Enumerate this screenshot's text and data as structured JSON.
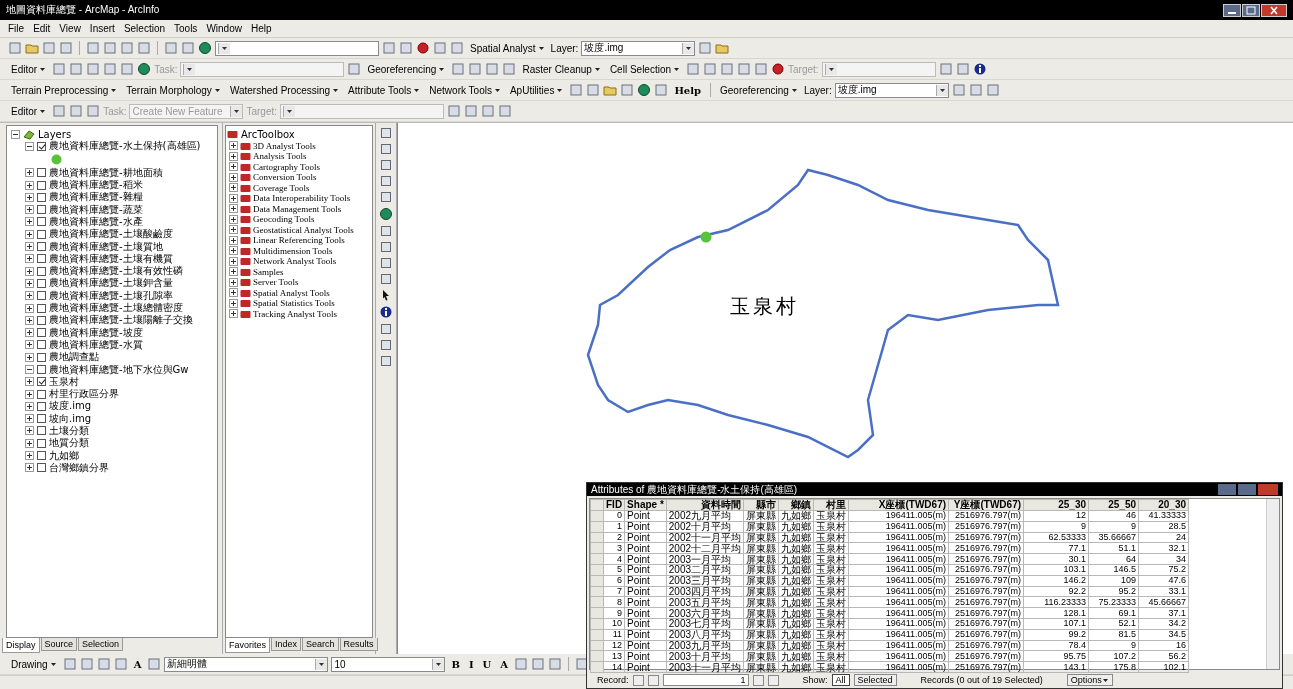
{
  "window": {
    "title": "地圖資料庫總覽 - ArcMap - ArcInfo"
  },
  "menu": [
    "File",
    "Edit",
    "View",
    "Insert",
    "Selection",
    "Tools",
    "Window",
    "Help"
  ],
  "toolbars": [
    [
      {
        "kind": "icon"
      },
      {
        "kind": "folder"
      },
      {
        "kind": "icon"
      },
      {
        "kind": "icon"
      },
      {
        "kind": "sep"
      },
      {
        "kind": "icon"
      },
      {
        "kind": "icon"
      },
      {
        "kind": "icon"
      },
      {
        "kind": "icon"
      },
      {
        "kind": "sep"
      },
      {
        "kind": "icon"
      },
      {
        "kind": "icon"
      },
      {
        "kind": "globe"
      },
      {
        "kind": "widecombo",
        "disabled": false
      },
      {
        "kind": "icon"
      },
      {
        "kind": "icon"
      },
      {
        "kind": "ball"
      },
      {
        "kind": "icon"
      },
      {
        "kind": "icon"
      },
      {
        "kind": "menu",
        "label": "Spatial Analyst"
      },
      {
        "kind": "combo",
        "label": "Layer:",
        "value": "坡度.img",
        "disabled": false
      },
      {
        "kind": "icon"
      },
      {
        "kind": "folder"
      }
    ],
    [
      {
        "kind": "menu",
        "label": "Editor"
      },
      {
        "kind": "icon"
      },
      {
        "kind": "icon"
      },
      {
        "kind": "icon"
      },
      {
        "kind": "icon"
      },
      {
        "kind": "icon"
      },
      {
        "kind": "globe"
      },
      {
        "kind": "widecombo",
        "label": "Task:",
        "disabled": true
      },
      {
        "kind": "icon"
      },
      {
        "kind": "menu",
        "label": "Georeferencing"
      },
      {
        "kind": "icon"
      },
      {
        "kind": "icon"
      },
      {
        "kind": "icon"
      },
      {
        "kind": "icon"
      },
      {
        "kind": "menu",
        "label": "Raster Cleanup"
      },
      {
        "kind": "menu",
        "label": "Cell Selection"
      },
      {
        "kind": "icon"
      },
      {
        "kind": "icon"
      },
      {
        "kind": "icon"
      },
      {
        "kind": "icon"
      },
      {
        "kind": "icon"
      },
      {
        "kind": "ball"
      },
      {
        "kind": "combo",
        "label": "Target:",
        "disabled": true
      },
      {
        "kind": "icon"
      },
      {
        "kind": "icon"
      },
      {
        "kind": "info"
      }
    ],
    [
      {
        "kind": "menu",
        "label": "Terrain Preprocessing"
      },
      {
        "kind": "menu",
        "label": "Terrain Morphology"
      },
      {
        "kind": "menu",
        "label": "Watershed Processing"
      },
      {
        "kind": "menu",
        "label": "Attribute Tools"
      },
      {
        "kind": "menu",
        "label": "Network Tools"
      },
      {
        "kind": "menu",
        "label": "ApUtilities"
      },
      {
        "kind": "icon"
      },
      {
        "kind": "icon"
      },
      {
        "kind": "folder"
      },
      {
        "kind": "icon"
      },
      {
        "kind": "globe"
      },
      {
        "kind": "icon"
      },
      {
        "kind": "text",
        "label": "Help"
      },
      {
        "kind": "sep"
      },
      {
        "kind": "menu",
        "label": "Georeferencing"
      },
      {
        "kind": "combo",
        "label": "Layer:",
        "value": "坡度.img",
        "disabled": false
      },
      {
        "kind": "icon"
      },
      {
        "kind": "icon"
      },
      {
        "kind": "icon"
      }
    ],
    [
      {
        "kind": "menu",
        "label": "Editor"
      },
      {
        "kind": "icon"
      },
      {
        "kind": "icon"
      },
      {
        "kind": "icon"
      },
      {
        "kind": "combo",
        "label": "Task:",
        "value": "Create New Feature",
        "disabled": true
      },
      {
        "kind": "widecombo",
        "label": "Target:",
        "disabled": true
      },
      {
        "kind": "icon"
      },
      {
        "kind": "icon"
      },
      {
        "kind": "icon"
      },
      {
        "kind": "icon"
      }
    ]
  ],
  "toc": {
    "root": "Layers",
    "layers": [
      {
        "name": "農地資料庫總覽-水土保持(高雄區)",
        "checked": true,
        "expanded": true
      },
      {
        "name": "農地資料庫總覽-耕地面積",
        "checked": false,
        "expanded": false
      },
      {
        "name": "農地資料庫總覽-稻米",
        "checked": false,
        "expanded": false
      },
      {
        "name": "農地資料庫總覽-雜糧",
        "checked": false,
        "expanded": false
      },
      {
        "name": "農地資料庫總覽-蔬菜",
        "checked": false,
        "expanded": false
      },
      {
        "name": "農地資料庫總覽-水產",
        "checked": false,
        "expanded": false
      },
      {
        "name": "農地資料庫總覽-土壤酸鹼度",
        "checked": false,
        "expanded": false
      },
      {
        "name": "農地資料庫總覽-土壤質地",
        "checked": false,
        "expanded": false
      },
      {
        "name": "農地資料庫總覽-土壤有機質",
        "checked": false,
        "expanded": false
      },
      {
        "name": "農地資料庫總覽-土壤有效性磷",
        "checked": false,
        "expanded": false
      },
      {
        "name": "農地資料庫總覽-土壤鉀含量",
        "checked": false,
        "expanded": false
      },
      {
        "name": "農地資料庫總覽-土壤孔隙率",
        "checked": false,
        "expanded": false
      },
      {
        "name": "農地資料庫總覽-土壤總體密度",
        "checked": false,
        "expanded": false
      },
      {
        "name": "農地資料庫總覽-土壤陽離子交換",
        "checked": false,
        "expanded": false
      },
      {
        "name": "農地資料庫總覽-坡度",
        "checked": false,
        "expanded": false
      },
      {
        "name": "農地資料庫總覽-水質",
        "checked": false,
        "expanded": false
      },
      {
        "name": "農地調查點",
        "checked": false,
        "expanded": false
      },
      {
        "name": "農地資料庫總覽-地下水位與Gw",
        "checked": false,
        "expanded": true
      },
      {
        "name": "玉泉村",
        "checked": true,
        "expanded": false
      },
      {
        "name": "村里行政區分界",
        "checked": false,
        "expanded": false
      },
      {
        "name": "坡度.img",
        "checked": false,
        "expanded": false
      },
      {
        "name": "坡向.img",
        "checked": false,
        "expanded": false
      },
      {
        "name": "土壤分類",
        "checked": false,
        "expanded": false
      },
      {
        "name": "地質分類",
        "checked": false,
        "expanded": false
      },
      {
        "name": "九如鄉",
        "checked": false,
        "expanded": false
      },
      {
        "name": "台灣鄉鎮分界",
        "checked": false,
        "expanded": false
      }
    ],
    "tabs": [
      {
        "label": "Display",
        "selected": true
      },
      {
        "label": "Source",
        "selected": false
      },
      {
        "label": "Selection",
        "selected": false
      }
    ]
  },
  "toolbox": {
    "root": "ArcToolbox",
    "items": [
      "3D Analyst Tools",
      "Analysis Tools",
      "Cartography Tools",
      "Conversion Tools",
      "Coverage Tools",
      "Data Interoperability Tools",
      "Data Management Tools",
      "Geocoding Tools",
      "Geostatistical Analyst Tools",
      "Linear Referencing Tools",
      "Multidimension Tools",
      "Network Analyst Tools",
      "Samples",
      "Server Tools",
      "Spatial Analyst Tools",
      "Spatial Statistics Tools",
      "Tracking Analyst Tools"
    ],
    "tabs": [
      {
        "label": "Favorites",
        "selected": true
      },
      {
        "label": "Index",
        "selected": false
      },
      {
        "label": "Search",
        "selected": false
      },
      {
        "label": "Results",
        "selected": false
      }
    ]
  },
  "map": {
    "label": "玉泉村"
  },
  "table": {
    "title": "Attributes of 農地資料庫總覽-水土保持(高雄區)",
    "columns": [
      "FID",
      "Shape *",
      "資料時間",
      "縣市",
      "鄉鎮",
      "村里",
      "X座標(TWD67)",
      "Y座標(TWD67)",
      "25_30",
      "25_50",
      "20_30"
    ],
    "rows": [
      [
        "0",
        "Point",
        "2002九月平均",
        "屏東縣",
        "九如鄉",
        "玉泉村",
        "196411.005(m)",
        "2516976.797(m)",
        "12",
        "46",
        "41.33333"
      ],
      [
        "1",
        "Point",
        "2002十月平均",
        "屏東縣",
        "九如鄉",
        "玉泉村",
        "196411.005(m)",
        "2516976.797(m)",
        "9",
        "9",
        "28.5"
      ],
      [
        "2",
        "Point",
        "2002十一月平均",
        "屏東縣",
        "九如鄉",
        "玉泉村",
        "196411.005(m)",
        "2516976.797(m)",
        "62.53333",
        "35.66667",
        "24"
      ],
      [
        "3",
        "Point",
        "2002十二月平均",
        "屏東縣",
        "九如鄉",
        "玉泉村",
        "196411.005(m)",
        "2516976.797(m)",
        "77.1",
        "51.1",
        "32.1"
      ],
      [
        "4",
        "Point",
        "2003一月平均",
        "屏東縣",
        "九如鄉",
        "玉泉村",
        "196411.005(m)",
        "2516976.797(m)",
        "30.1",
        "64",
        "34"
      ],
      [
        "5",
        "Point",
        "2003二月平均",
        "屏東縣",
        "九如鄉",
        "玉泉村",
        "196411.005(m)",
        "2516976.797(m)",
        "103.1",
        "146.5",
        "75.2"
      ],
      [
        "6",
        "Point",
        "2003三月平均",
        "屏東縣",
        "九如鄉",
        "玉泉村",
        "196411.005(m)",
        "2516976.797(m)",
        "146.2",
        "109",
        "47.6"
      ],
      [
        "7",
        "Point",
        "2003四月平均",
        "屏東縣",
        "九如鄉",
        "玉泉村",
        "196411.005(m)",
        "2516976.797(m)",
        "92.2",
        "95.2",
        "33.1"
      ],
      [
        "8",
        "Point",
        "2003五月平均",
        "屏東縣",
        "九如鄉",
        "玉泉村",
        "196411.005(m)",
        "2516976.797(m)",
        "116.23333",
        "75.23333",
        "45.66667"
      ],
      [
        "9",
        "Point",
        "2003六月平均",
        "屏東縣",
        "九如鄉",
        "玉泉村",
        "196411.005(m)",
        "2516976.797(m)",
        "128.1",
        "69.1",
        "37.1"
      ],
      [
        "10",
        "Point",
        "2003七月平均",
        "屏東縣",
        "九如鄉",
        "玉泉村",
        "196411.005(m)",
        "2516976.797(m)",
        "107.1",
        "52.1",
        "34.2"
      ],
      [
        "11",
        "Point",
        "2003八月平均",
        "屏東縣",
        "九如鄉",
        "玉泉村",
        "196411.005(m)",
        "2516976.797(m)",
        "99.2",
        "81.5",
        "34.5"
      ],
      [
        "12",
        "Point",
        "2003九月平均",
        "屏東縣",
        "九如鄉",
        "玉泉村",
        "196411.005(m)",
        "2516976.797(m)",
        "78.4",
        "9",
        "16"
      ],
      [
        "13",
        "Point",
        "2003十月平均",
        "屏東縣",
        "九如鄉",
        "玉泉村",
        "196411.005(m)",
        "2516976.797(m)",
        "95.75",
        "107.2",
        "56.2"
      ],
      [
        "14",
        "Point",
        "2003十一月平均",
        "屏東縣",
        "九如鄉",
        "玉泉村",
        "196411.005(m)",
        "2516976.797(m)",
        "143.1",
        "175.8",
        "102.1"
      ]
    ],
    "record_label": "Record:",
    "record_value": "1",
    "show_label": "Show:",
    "show_buttons": [
      {
        "label": "All",
        "selected": true
      },
      {
        "label": "Selected",
        "selected": false
      }
    ],
    "records_text": "Records (0 out of 19 Selected)",
    "options": "Options"
  },
  "drawing": [
    {
      "kind": "menu",
      "label": "Drawing"
    },
    {
      "kind": "icon"
    },
    {
      "kind": "icon"
    },
    {
      "kind": "icon"
    },
    {
      "kind": "icon"
    },
    {
      "kind": "text",
      "label": "A"
    },
    {
      "kind": "icon"
    },
    {
      "kind": "widecombo",
      "value": "新細明體",
      "disabled": false
    },
    {
      "kind": "combo",
      "value": "10",
      "disabled": false
    },
    {
      "kind": "text",
      "label": "B"
    },
    {
      "kind": "text",
      "label": "I"
    },
    {
      "kind": "text",
      "label": "U"
    },
    {
      "kind": "text",
      "label": "A"
    },
    {
      "kind": "icon"
    },
    {
      "kind": "icon"
    },
    {
      "kind": "icon"
    },
    {
      "kind": "sep"
    },
    {
      "kind": "icon"
    }
  ]
}
